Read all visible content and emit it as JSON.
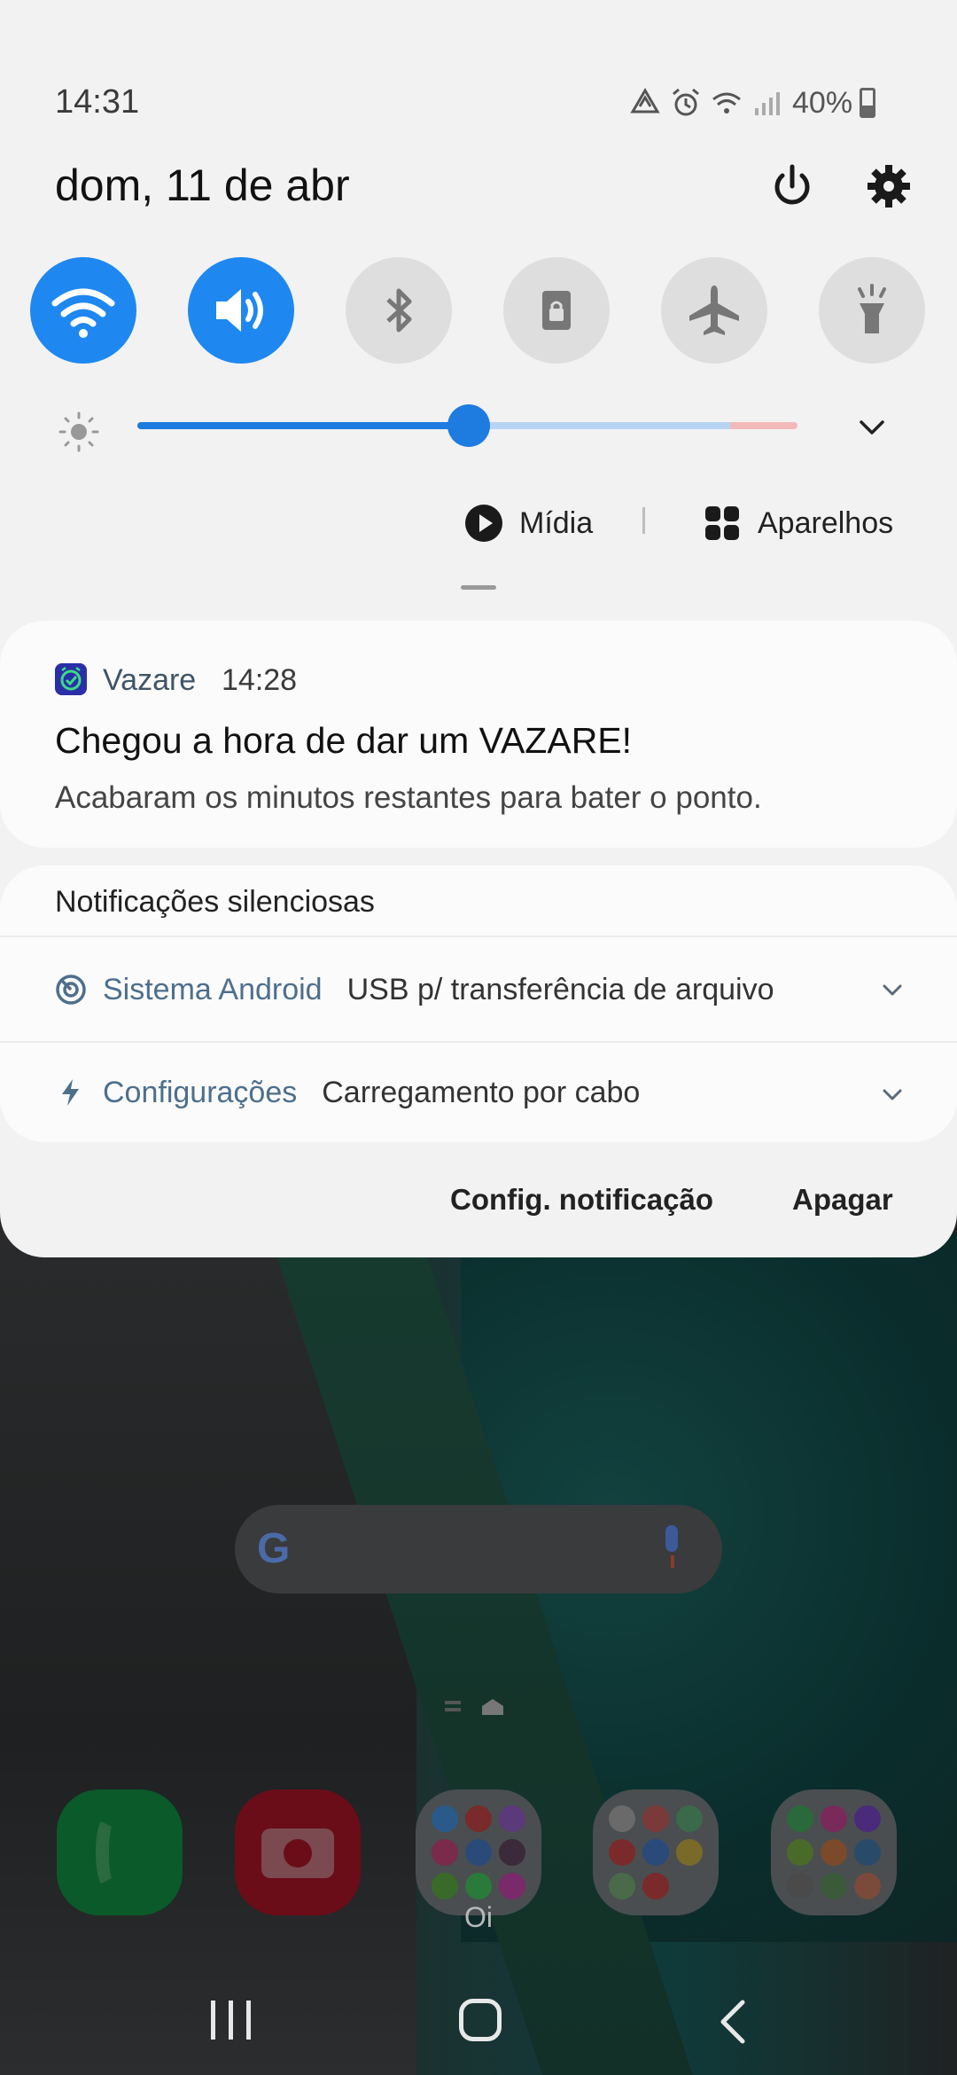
{
  "status_bar": {
    "time": "14:31",
    "battery": "40%",
    "icons": [
      "wifi-sync-icon",
      "alarm-icon",
      "wifi-icon",
      "signal-icon",
      "battery-charging-icon"
    ]
  },
  "header": {
    "date": "dom, 11 de abr",
    "power_icon": "power-icon",
    "settings_icon": "gear-icon"
  },
  "quick_settings": [
    {
      "name": "wifi",
      "icon": "wifi-icon",
      "state": "on"
    },
    {
      "name": "sound",
      "icon": "speaker-icon",
      "state": "on"
    },
    {
      "name": "bluetooth",
      "icon": "bluetooth-icon",
      "state": "off"
    },
    {
      "name": "rotation-lock",
      "icon": "lock-icon",
      "state": "off"
    },
    {
      "name": "airplane",
      "icon": "airplane-icon",
      "state": "off"
    },
    {
      "name": "flashlight",
      "icon": "flashlight-icon",
      "state": "off"
    }
  ],
  "brightness": {
    "level": 0.5
  },
  "media_controls": {
    "media_label": "Mídia",
    "devices_label": "Aparelhos"
  },
  "notification": {
    "app_name": "Vazare",
    "time": "14:28",
    "title": "Chegou a hora de dar um VAZARE!",
    "body": "Acabaram os minutos restantes para bater o ponto."
  },
  "silent": {
    "header": "Notificações silenciosas",
    "items": [
      {
        "app": "Sistema Android",
        "text": "USB p/ transferência de arquivo",
        "icon": "android-system-icon"
      },
      {
        "app": "Configurações",
        "text": "Carregamento por cabo",
        "icon": "lightning-icon"
      }
    ]
  },
  "actions": {
    "config_label": "Config. notificação",
    "clear_label": "Apagar"
  },
  "home_screen": {
    "folder_label": "Oi"
  },
  "colors": {
    "accent": "#1e88f0",
    "panel": "#f2f2f2",
    "card": "#fbfbfb"
  }
}
